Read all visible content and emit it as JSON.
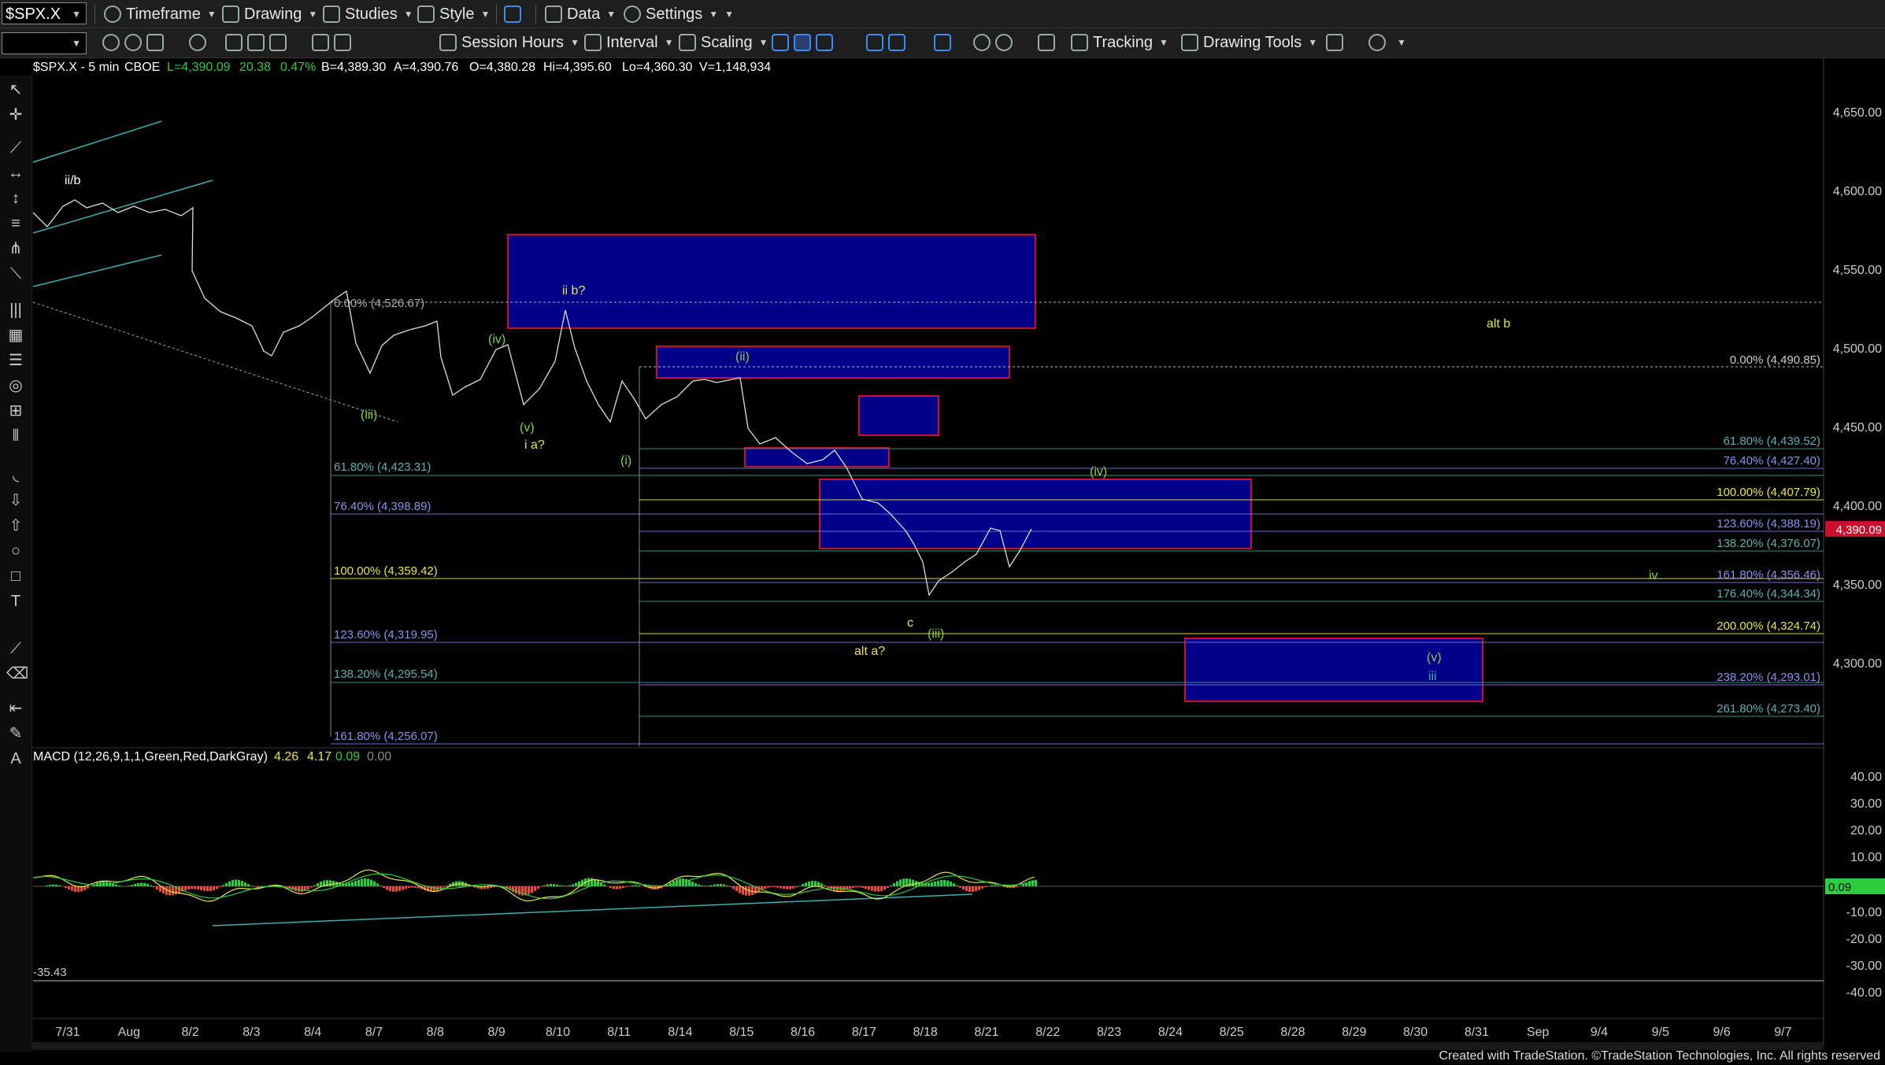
{
  "toolbar1": {
    "symbol": "$SPX.X",
    "timeframe": "Timeframe",
    "drawing": "Drawing",
    "studies": "Studies",
    "style": "Style",
    "data": "Data",
    "settings": "Settings"
  },
  "toolbar2": {
    "session_hours": "Session Hours",
    "interval": "Interval",
    "scaling": "Scaling",
    "tracking": "Tracking",
    "drawing_tools": "Drawing Tools"
  },
  "header": {
    "symbol_info": "$SPX.X - 5 min",
    "exchange": "CBOE",
    "last": "L=4,390.09",
    "change": "20.38",
    "change_pct": "0.47%",
    "bid": "B=4,389.30",
    "ask": "A=4,390.76",
    "open": "O=4,380.28",
    "high": "Hi=4,395.60",
    "low": "Lo=4,360.30",
    "volume": "V=1,148,934"
  },
  "price_axis": {
    "ticks": [
      "4,650.00",
      "4,600.00",
      "4,550.00",
      "4,500.00",
      "4,450.00",
      "4,400.00",
      "4,350.00",
      "4,300.00"
    ],
    "current_price": "4,390.09"
  },
  "macd": {
    "title": "MACD (12,26,9,1,1,Green,Red,DarkGray)",
    "v1": "4.26",
    "v2": "4.17",
    "v3": "0.09",
    "v4": "0.00",
    "ticks": [
      "40.00",
      "30.00",
      "20.00",
      "10.00",
      "-10.00",
      "-20.00",
      "-30.00",
      "-40.00"
    ],
    "current": "0.09",
    "min_label": "-35.43"
  },
  "time_axis": [
    "7/31",
    "Aug",
    "8/2",
    "8/3",
    "8/4",
    "8/7",
    "8/8",
    "8/9",
    "8/10",
    "8/11",
    "8/14",
    "8/15",
    "8/16",
    "8/17",
    "8/18",
    "8/21",
    "8/22",
    "8/23",
    "8/24",
    "8/25",
    "8/28",
    "8/29",
    "8/30",
    "8/31",
    "Sep",
    "9/4",
    "9/5",
    "9/6",
    "9/7"
  ],
  "fib_left": [
    "0.00% (4,526.67)",
    "61.80% (4,423.31)",
    "76.40% (4,398.89)",
    "100.00% (4,359.42)",
    "123.60% (4,319.95)",
    "138.20% (4,295.54)",
    "161.80% (4,256.07)"
  ],
  "fib_right": [
    "0.00% (4,490.85)",
    "61.80% (4,439.52)",
    "76.40% (4,427.40)",
    "100.00% (4,407.79)",
    "123.60% (4,388.19)",
    "138.20% (4,376.07)",
    "161.80% (4,356.46)",
    "176.40% (4,344.34)",
    "200.00% (4,324.74)",
    "238.20% (4,293.01)",
    "261.80% (4,273.40)"
  ],
  "wave_labels": {
    "iib": "ii/b",
    "iii_small": "(iii)",
    "iv_small": "(iv)",
    "v_small": "(v)",
    "i_a": "i a?",
    "ii_b": "ii b?",
    "i_paren": "(i)",
    "ii_paren": "(ii)",
    "iv_paren": "(iv)",
    "c": "c",
    "iii_paren": "(iii)",
    "alt_a": "alt a?",
    "alt_b": "alt b",
    "v_paren": "(v)",
    "iii": "iii",
    "iv": "iv"
  },
  "footer": "Created with TradeStation. ©TradeStation Technologies, Inc. All rights reserved",
  "colors": {
    "up": "#2ecc40",
    "down": "#e74c3c",
    "box": "#00008b",
    "box_border": "#c8102e",
    "fib_blue": "#6b6bd0",
    "fib_yellow": "#d8d840",
    "fib_teal": "#3a8a8a",
    "label_green": "#7fd83a",
    "label_yellow": "#e6e64a"
  }
}
